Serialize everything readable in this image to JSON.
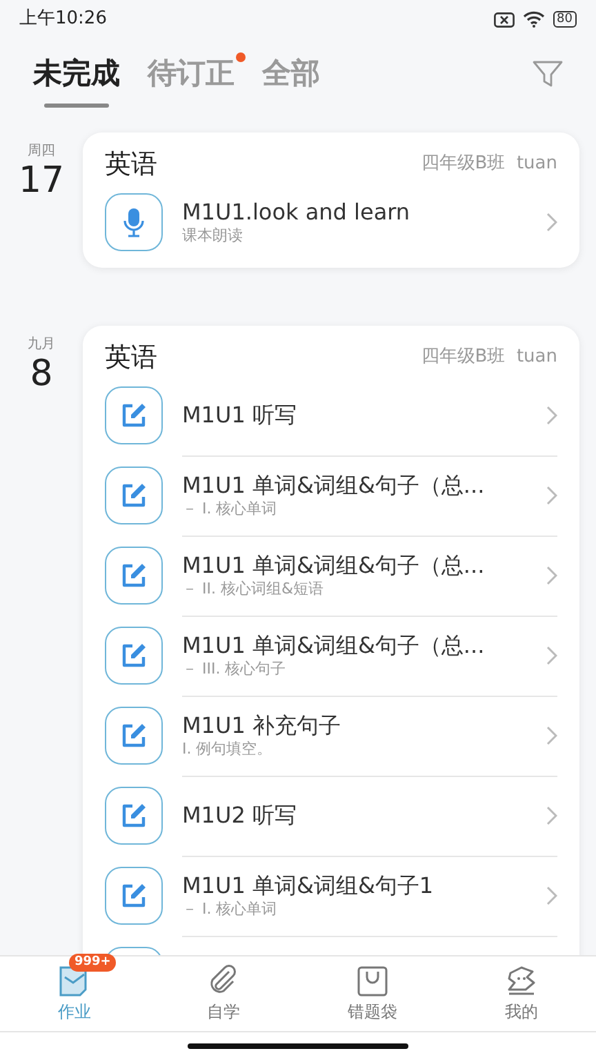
{
  "status_bar": {
    "time": "上午10:26",
    "battery": "80"
  },
  "tabs": [
    {
      "label": "未完成",
      "selected": true,
      "dot": false
    },
    {
      "label": "待订正",
      "selected": false,
      "dot": true
    },
    {
      "label": "全部",
      "selected": false,
      "dot": false
    }
  ],
  "groups": [
    {
      "date_label": "周四",
      "day": "17",
      "subject": "英语",
      "class_info": "四年级B班  tuan",
      "items": [
        {
          "kind": "audio",
          "title": "M1U1.look and learn",
          "subtitle": "课本朗读"
        }
      ]
    },
    {
      "date_label": "九月",
      "day": "8",
      "subject": "英语",
      "class_info": "四年级B班  tuan",
      "items": [
        {
          "kind": "write",
          "title": "M1U1 听写"
        },
        {
          "kind": "write",
          "title": "M1U1 单词&词组&句子（总...",
          "subtitle": "－ I. 核心单词"
        },
        {
          "kind": "write",
          "title": "M1U1 单词&词组&句子（总...",
          "subtitle": "－ II. 核心词组&短语"
        },
        {
          "kind": "write",
          "title": "M1U1 单词&词组&句子（总...",
          "subtitle": "－ III. 核心句子"
        },
        {
          "kind": "write",
          "title": "M1U1 补充句子",
          "subtitle": "I. 例句填空。"
        },
        {
          "kind": "write",
          "title": "M1U2 听写"
        },
        {
          "kind": "write",
          "title": "M1U1 单词&词组&句子1",
          "subtitle": "－ I. 核心单词"
        },
        {
          "kind": "write"
        }
      ]
    }
  ],
  "bottom_nav": [
    {
      "kind": "homework",
      "label": "作业",
      "selected": true,
      "badge": "999+"
    },
    {
      "kind": "study",
      "label": "自学",
      "selected": false
    },
    {
      "kind": "bag",
      "label": "错题袋",
      "selected": false
    },
    {
      "kind": "me",
      "label": "我的",
      "selected": false
    }
  ]
}
